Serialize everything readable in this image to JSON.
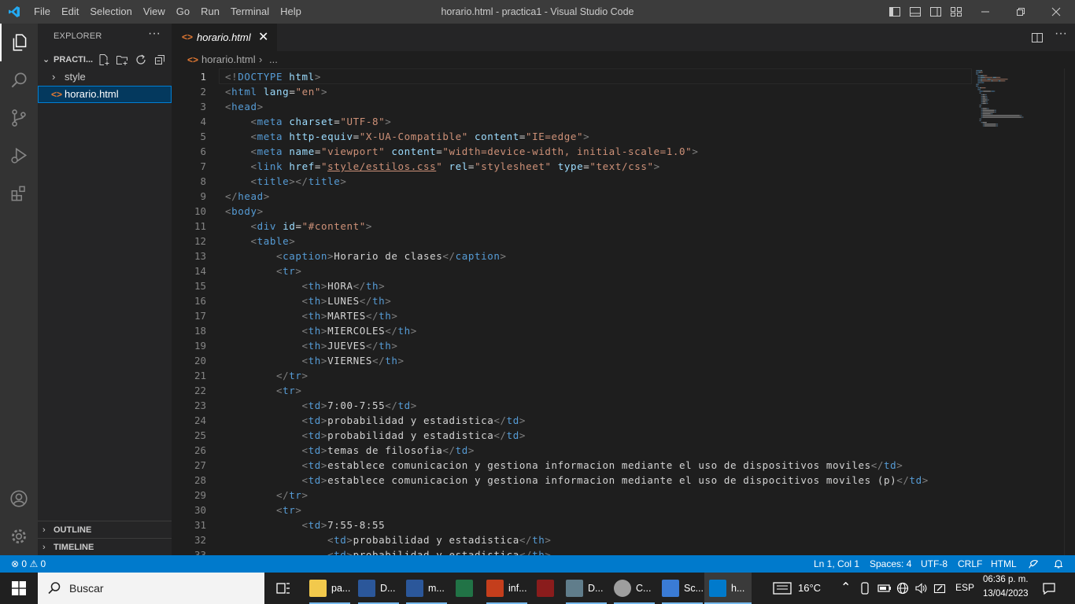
{
  "titlebar": {
    "menu": [
      "File",
      "Edit",
      "Selection",
      "View",
      "Go",
      "Run",
      "Terminal",
      "Help"
    ],
    "title": "horario.html - practica1 - Visual Studio Code"
  },
  "sidebar": {
    "title": "EXPLORER",
    "folder": "PRACTI...",
    "items": [
      {
        "label": "style",
        "kind": "folder"
      },
      {
        "label": "horario.html",
        "kind": "file"
      }
    ],
    "outline": "OUTLINE",
    "timeline": "TIMELINE"
  },
  "tab": {
    "label": "horario.html"
  },
  "breadcrumb": {
    "file": "horario.html",
    "more": "..."
  },
  "code_lines": [
    [
      [
        "br",
        "<!"
      ],
      [
        "dt",
        "DOCTYPE"
      ],
      [
        "tx",
        " "
      ],
      [
        "at",
        "html"
      ],
      [
        "br",
        ">"
      ]
    ],
    [
      [
        "br",
        "<"
      ],
      [
        "tag",
        "html"
      ],
      [
        "tx",
        " "
      ],
      [
        "at",
        "lang"
      ],
      [
        "tx",
        "="
      ],
      [
        "st",
        "\"en\""
      ],
      [
        "br",
        ">"
      ]
    ],
    [
      [
        "br",
        "<"
      ],
      [
        "tag",
        "head"
      ],
      [
        "br",
        ">"
      ]
    ],
    [
      [
        "tx",
        "    "
      ],
      [
        "br",
        "<"
      ],
      [
        "tag",
        "meta"
      ],
      [
        "tx",
        " "
      ],
      [
        "at",
        "charset"
      ],
      [
        "tx",
        "="
      ],
      [
        "st",
        "\"UTF-8\""
      ],
      [
        "br",
        ">"
      ]
    ],
    [
      [
        "tx",
        "    "
      ],
      [
        "br",
        "<"
      ],
      [
        "tag",
        "meta"
      ],
      [
        "tx",
        " "
      ],
      [
        "at",
        "http-equiv"
      ],
      [
        "tx",
        "="
      ],
      [
        "st",
        "\"X-UA-Compatible\""
      ],
      [
        "tx",
        " "
      ],
      [
        "at",
        "content"
      ],
      [
        "tx",
        "="
      ],
      [
        "st",
        "\"IE=edge\""
      ],
      [
        "br",
        ">"
      ]
    ],
    [
      [
        "tx",
        "    "
      ],
      [
        "br",
        "<"
      ],
      [
        "tag",
        "meta"
      ],
      [
        "tx",
        " "
      ],
      [
        "at",
        "name"
      ],
      [
        "tx",
        "="
      ],
      [
        "st",
        "\"viewport\""
      ],
      [
        "tx",
        " "
      ],
      [
        "at",
        "content"
      ],
      [
        "tx",
        "="
      ],
      [
        "st",
        "\"width=device-width, initial-scale=1.0\""
      ],
      [
        "br",
        ">"
      ]
    ],
    [
      [
        "tx",
        "    "
      ],
      [
        "br",
        "<"
      ],
      [
        "tag",
        "link"
      ],
      [
        "tx",
        " "
      ],
      [
        "at",
        "href"
      ],
      [
        "tx",
        "="
      ],
      [
        "st",
        "\""
      ],
      [
        "stu",
        "style/estilos.css"
      ],
      [
        "st",
        "\""
      ],
      [
        "tx",
        " "
      ],
      [
        "at",
        "rel"
      ],
      [
        "tx",
        "="
      ],
      [
        "st",
        "\"stylesheet\""
      ],
      [
        "tx",
        " "
      ],
      [
        "at",
        "type"
      ],
      [
        "tx",
        "="
      ],
      [
        "st",
        "\"text/css\""
      ],
      [
        "br",
        ">"
      ]
    ],
    [
      [
        "tx",
        "    "
      ],
      [
        "br",
        "<"
      ],
      [
        "tag",
        "title"
      ],
      [
        "br",
        "></"
      ],
      [
        "tag",
        "title"
      ],
      [
        "br",
        ">"
      ]
    ],
    [
      [
        "br",
        "</"
      ],
      [
        "tag",
        "head"
      ],
      [
        "br",
        ">"
      ]
    ],
    [
      [
        "br",
        "<"
      ],
      [
        "tag",
        "body"
      ],
      [
        "br",
        ">"
      ]
    ],
    [
      [
        "tx",
        "    "
      ],
      [
        "br",
        "<"
      ],
      [
        "tag",
        "div"
      ],
      [
        "tx",
        " "
      ],
      [
        "at",
        "id"
      ],
      [
        "tx",
        "="
      ],
      [
        "st",
        "\"#content\""
      ],
      [
        "br",
        ">"
      ]
    ],
    [
      [
        "tx",
        "    "
      ],
      [
        "br",
        "<"
      ],
      [
        "tag",
        "table"
      ],
      [
        "br",
        ">"
      ]
    ],
    [
      [
        "tx",
        "        "
      ],
      [
        "br",
        "<"
      ],
      [
        "tag",
        "caption"
      ],
      [
        "br",
        ">"
      ],
      [
        "tx",
        "Horario de clases"
      ],
      [
        "br",
        "</"
      ],
      [
        "tag",
        "caption"
      ],
      [
        "br",
        ">"
      ]
    ],
    [
      [
        "tx",
        "        "
      ],
      [
        "br",
        "<"
      ],
      [
        "tag",
        "tr"
      ],
      [
        "br",
        ">"
      ]
    ],
    [
      [
        "tx",
        "            "
      ],
      [
        "br",
        "<"
      ],
      [
        "tag",
        "th"
      ],
      [
        "br",
        ">"
      ],
      [
        "tx",
        "HORA"
      ],
      [
        "br",
        "</"
      ],
      [
        "tag",
        "th"
      ],
      [
        "br",
        ">"
      ]
    ],
    [
      [
        "tx",
        "            "
      ],
      [
        "br",
        "<"
      ],
      [
        "tag",
        "th"
      ],
      [
        "br",
        ">"
      ],
      [
        "tx",
        "LUNES"
      ],
      [
        "br",
        "</"
      ],
      [
        "tag",
        "th"
      ],
      [
        "br",
        ">"
      ]
    ],
    [
      [
        "tx",
        "            "
      ],
      [
        "br",
        "<"
      ],
      [
        "tag",
        "th"
      ],
      [
        "br",
        ">"
      ],
      [
        "tx",
        "MARTES"
      ],
      [
        "br",
        "</"
      ],
      [
        "tag",
        "th"
      ],
      [
        "br",
        ">"
      ]
    ],
    [
      [
        "tx",
        "            "
      ],
      [
        "br",
        "<"
      ],
      [
        "tag",
        "th"
      ],
      [
        "br",
        ">"
      ],
      [
        "tx",
        "MIERCOLES"
      ],
      [
        "br",
        "</"
      ],
      [
        "tag",
        "th"
      ],
      [
        "br",
        ">"
      ]
    ],
    [
      [
        "tx",
        "            "
      ],
      [
        "br",
        "<"
      ],
      [
        "tag",
        "th"
      ],
      [
        "br",
        ">"
      ],
      [
        "tx",
        "JUEVES"
      ],
      [
        "br",
        "</"
      ],
      [
        "tag",
        "th"
      ],
      [
        "br",
        ">"
      ]
    ],
    [
      [
        "tx",
        "            "
      ],
      [
        "br",
        "<"
      ],
      [
        "tag",
        "th"
      ],
      [
        "br",
        ">"
      ],
      [
        "tx",
        "VIERNES"
      ],
      [
        "br",
        "</"
      ],
      [
        "tag",
        "th"
      ],
      [
        "br",
        ">"
      ]
    ],
    [
      [
        "tx",
        "        "
      ],
      [
        "br",
        "</"
      ],
      [
        "tag",
        "tr"
      ],
      [
        "br",
        ">"
      ]
    ],
    [
      [
        "tx",
        "        "
      ],
      [
        "br",
        "<"
      ],
      [
        "tag",
        "tr"
      ],
      [
        "br",
        ">"
      ]
    ],
    [
      [
        "tx",
        "            "
      ],
      [
        "br",
        "<"
      ],
      [
        "tag",
        "td"
      ],
      [
        "br",
        ">"
      ],
      [
        "tx",
        "7:00-7:55"
      ],
      [
        "br",
        "</"
      ],
      [
        "tag",
        "td"
      ],
      [
        "br",
        ">"
      ]
    ],
    [
      [
        "tx",
        "            "
      ],
      [
        "br",
        "<"
      ],
      [
        "tag",
        "td"
      ],
      [
        "br",
        ">"
      ],
      [
        "tx",
        "probabilidad y estadistica"
      ],
      [
        "br",
        "</"
      ],
      [
        "tag",
        "td"
      ],
      [
        "br",
        ">"
      ]
    ],
    [
      [
        "tx",
        "            "
      ],
      [
        "br",
        "<"
      ],
      [
        "tag",
        "td"
      ],
      [
        "br",
        ">"
      ],
      [
        "tx",
        "probabilidad y estadistica"
      ],
      [
        "br",
        "</"
      ],
      [
        "tag",
        "td"
      ],
      [
        "br",
        ">"
      ]
    ],
    [
      [
        "tx",
        "            "
      ],
      [
        "br",
        "<"
      ],
      [
        "tag",
        "td"
      ],
      [
        "br",
        ">"
      ],
      [
        "tx",
        "temas de filosofia"
      ],
      [
        "br",
        "</"
      ],
      [
        "tag",
        "td"
      ],
      [
        "br",
        ">"
      ]
    ],
    [
      [
        "tx",
        "            "
      ],
      [
        "br",
        "<"
      ],
      [
        "tag",
        "td"
      ],
      [
        "br",
        ">"
      ],
      [
        "tx",
        "establece comunicacion y gestiona informacion mediante el uso de dispositivos moviles"
      ],
      [
        "br",
        "</"
      ],
      [
        "tag",
        "td"
      ],
      [
        "br",
        ">"
      ]
    ],
    [
      [
        "tx",
        "            "
      ],
      [
        "br",
        "<"
      ],
      [
        "tag",
        "td"
      ],
      [
        "br",
        ">"
      ],
      [
        "tx",
        "establece comunicacion y gestiona informacion mediante el uso de dispocitivos moviles (p)"
      ],
      [
        "br",
        "</"
      ],
      [
        "tag",
        "td"
      ],
      [
        "br",
        ">"
      ]
    ],
    [
      [
        "tx",
        "        "
      ],
      [
        "br",
        "</"
      ],
      [
        "tag",
        "tr"
      ],
      [
        "br",
        ">"
      ]
    ],
    [
      [
        "tx",
        "        "
      ],
      [
        "br",
        "<"
      ],
      [
        "tag",
        "tr"
      ],
      [
        "br",
        ">"
      ]
    ],
    [
      [
        "tx",
        "            "
      ],
      [
        "br",
        "<"
      ],
      [
        "tag",
        "td"
      ],
      [
        "br",
        ">"
      ],
      [
        "tx",
        "7:55-8:55"
      ]
    ],
    [
      [
        "tx",
        "                "
      ],
      [
        "br",
        "<"
      ],
      [
        "tag",
        "td"
      ],
      [
        "br",
        ">"
      ],
      [
        "tx",
        "probabilidad y estadistica"
      ],
      [
        "br",
        "</"
      ],
      [
        "tag",
        "th"
      ],
      [
        "br",
        ">"
      ]
    ],
    [
      [
        "tx",
        "                "
      ],
      [
        "br",
        "<"
      ],
      [
        "tag",
        "td"
      ],
      [
        "br",
        ">"
      ],
      [
        "tx",
        "probabilidad y estadistica"
      ],
      [
        "br",
        "</"
      ],
      [
        "tag",
        "th"
      ],
      [
        "br",
        ">"
      ]
    ]
  ],
  "statusbar": {
    "errors": "0",
    "warnings": "0",
    "position": "Ln 1, Col 1",
    "spaces": "Spaces: 4",
    "encoding": "UTF-8",
    "eol": "CRLF",
    "language": "HTML"
  },
  "taskbar": {
    "search_placeholder": "Buscar",
    "apps": [
      {
        "label": "pa...",
        "color": "#f2c94c"
      },
      {
        "label": "D...",
        "color": "#2b579a"
      },
      {
        "label": "m...",
        "color": "#2b579a"
      },
      {
        "label": "",
        "color": "#217346"
      },
      {
        "label": "inf...",
        "color": "#c43e1c"
      },
      {
        "label": "",
        "color": "#8a1c1c"
      },
      {
        "label": "D...",
        "color": "#607d8b"
      },
      {
        "label": "C...",
        "color": "#9e9e9e"
      },
      {
        "label": "Sc...",
        "color": "#3a7bd5"
      },
      {
        "label": "h...",
        "color": "#007acc"
      }
    ],
    "weather": "16°C",
    "language": "ESP",
    "time": "06:36 p. m.",
    "date": "13/04/2023"
  },
  "colors": {
    "accent": "#007acc",
    "activity_bar": "#333333",
    "sidebar": "#252526",
    "editor": "#1e1e1e"
  }
}
